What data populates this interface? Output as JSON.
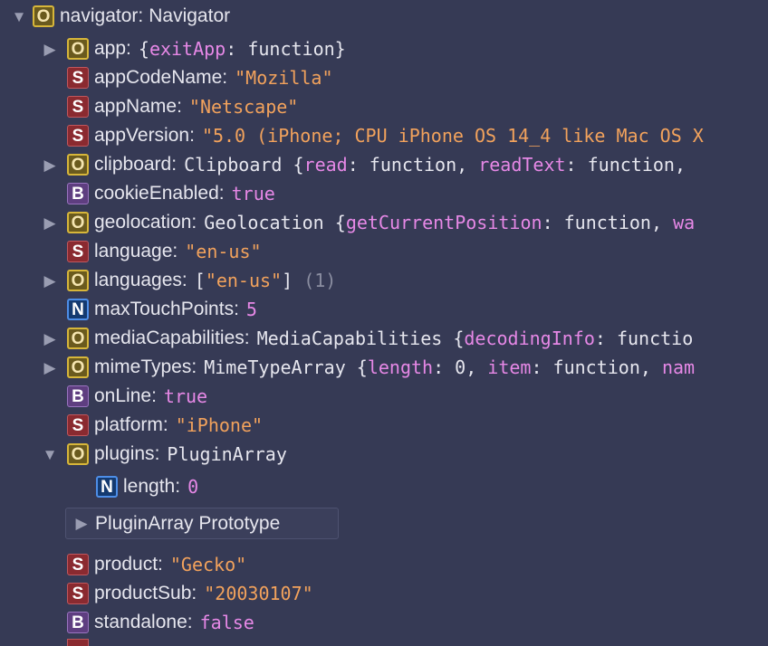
{
  "root": {
    "key": "navigator",
    "type_label": "Navigator",
    "badge": "O"
  },
  "props": [
    {
      "key": "app",
      "badge": "O",
      "expandable": true,
      "segments": [
        {
          "t": "{",
          "c": "fn"
        },
        {
          "t": "exitApp",
          "c": "prop"
        },
        {
          "t": ": function}",
          "c": "fn"
        }
      ]
    },
    {
      "key": "appCodeName",
      "badge": "S",
      "segments": [
        {
          "t": "\"Mozilla\"",
          "c": "str"
        }
      ]
    },
    {
      "key": "appName",
      "badge": "S",
      "segments": [
        {
          "t": "\"Netscape\"",
          "c": "str"
        }
      ]
    },
    {
      "key": "appVersion",
      "badge": "S",
      "segments": [
        {
          "t": "\"5.0 (iPhone; CPU iPhone OS 14_4 like Mac OS X",
          "c": "str"
        }
      ]
    },
    {
      "key": "clipboard",
      "badge": "O",
      "expandable": true,
      "segments": [
        {
          "t": "Clipboard {",
          "c": "cls"
        },
        {
          "t": "read",
          "c": "prop"
        },
        {
          "t": ": function, ",
          "c": "fn"
        },
        {
          "t": "readText",
          "c": "prop"
        },
        {
          "t": ": function, ",
          "c": "fn"
        }
      ]
    },
    {
      "key": "cookieEnabled",
      "badge": "B",
      "segments": [
        {
          "t": "true",
          "c": "kw"
        }
      ]
    },
    {
      "key": "geolocation",
      "badge": "O",
      "expandable": true,
      "segments": [
        {
          "t": "Geolocation {",
          "c": "cls"
        },
        {
          "t": "getCurrentPosition",
          "c": "prop"
        },
        {
          "t": ": function, ",
          "c": "fn"
        },
        {
          "t": "wa",
          "c": "prop"
        }
      ]
    },
    {
      "key": "language",
      "badge": "S",
      "segments": [
        {
          "t": "\"en-us\"",
          "c": "str"
        }
      ]
    },
    {
      "key": "languages",
      "badge": "O",
      "expandable": true,
      "segments": [
        {
          "t": "[",
          "c": "fn"
        },
        {
          "t": "\"en-us\"",
          "c": "str"
        },
        {
          "t": "] ",
          "c": "fn"
        },
        {
          "t": "(1)",
          "c": "cnt"
        }
      ]
    },
    {
      "key": "maxTouchPoints",
      "badge": "N",
      "segments": [
        {
          "t": "5",
          "c": "num"
        }
      ]
    },
    {
      "key": "mediaCapabilities",
      "badge": "O",
      "expandable": true,
      "segments": [
        {
          "t": "MediaCapabilities {",
          "c": "cls"
        },
        {
          "t": "decodingInfo",
          "c": "prop"
        },
        {
          "t": ": functio",
          "c": "fn"
        }
      ]
    },
    {
      "key": "mimeTypes",
      "badge": "O",
      "expandable": true,
      "segments": [
        {
          "t": "MimeTypeArray {",
          "c": "cls"
        },
        {
          "t": "length",
          "c": "prop"
        },
        {
          "t": ": 0, ",
          "c": "fn"
        },
        {
          "t": "item",
          "c": "prop"
        },
        {
          "t": ": function, ",
          "c": "fn"
        },
        {
          "t": "nam",
          "c": "prop"
        }
      ]
    },
    {
      "key": "onLine",
      "badge": "B",
      "segments": [
        {
          "t": "true",
          "c": "kw"
        }
      ]
    },
    {
      "key": "platform",
      "badge": "S",
      "segments": [
        {
          "t": "\"iPhone\"",
          "c": "str"
        }
      ]
    },
    {
      "key": "plugins",
      "badge": "O",
      "expanded": true,
      "segments": [
        {
          "t": "PluginArray",
          "c": "cls"
        }
      ]
    }
  ],
  "plugins_children": {
    "length": {
      "key": "length",
      "badge": "N",
      "value": "0"
    },
    "prototype_label": "PluginArray Prototype"
  },
  "props_after": [
    {
      "key": "product",
      "badge": "S",
      "segments": [
        {
          "t": "\"Gecko\"",
          "c": "str"
        }
      ]
    },
    {
      "key": "productSub",
      "badge": "S",
      "segments": [
        {
          "t": "\"20030107\"",
          "c": "str"
        }
      ]
    },
    {
      "key": "standalone",
      "badge": "B",
      "segments": [
        {
          "t": "false",
          "c": "kw"
        }
      ]
    }
  ],
  "colors": {
    "background": "#363a55",
    "string": "#f2a25c",
    "keyword": "#e688e6",
    "text": "#e6e6ee"
  }
}
